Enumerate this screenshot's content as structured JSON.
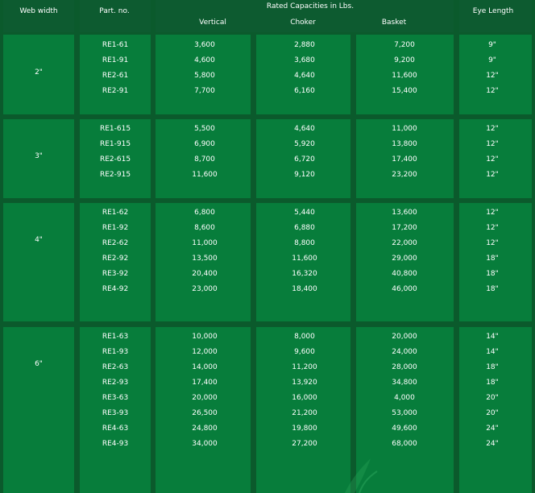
{
  "header": {
    "web_width": "Web width",
    "part_no": "Part. no.",
    "rated": "Rated Capacities in Lbs.",
    "vertical": "Vertical",
    "choker": "Choker",
    "basket": "Basket",
    "eye_length": "Eye Length"
  },
  "groups": [
    {
      "width": "2\"",
      "rows": [
        {
          "part": "RE1-61",
          "vertical": "3,600",
          "choker": "2,880",
          "basket": "7,200",
          "eye": "9\""
        },
        {
          "part": "RE1-91",
          "vertical": "4,600",
          "choker": "3,680",
          "basket": "9,200",
          "eye": "9\""
        },
        {
          "part": "RE2-61",
          "vertical": "5,800",
          "choker": "4,640",
          "basket": "11,600",
          "eye": "12\""
        },
        {
          "part": "RE2-91",
          "vertical": "7,700",
          "choker": "6,160",
          "basket": "15,400",
          "eye": "12\""
        }
      ]
    },
    {
      "width": "3\"",
      "rows": [
        {
          "part": "RE1-615",
          "vertical": "5,500",
          "choker": "4,640",
          "basket": "11,000",
          "eye": "12\""
        },
        {
          "part": "RE1-915",
          "vertical": "6,900",
          "choker": "5,920",
          "basket": "13,800",
          "eye": "12\""
        },
        {
          "part": "RE2-615",
          "vertical": "8,700",
          "choker": "6,720",
          "basket": "17,400",
          "eye": "12\""
        },
        {
          "part": "RE2-915",
          "vertical": "11,600",
          "choker": "9,120",
          "basket": "23,200",
          "eye": "12\""
        }
      ]
    },
    {
      "width": "4\"",
      "rows": [
        {
          "part": "RE1-62",
          "vertical": "6,800",
          "choker": "5,440",
          "basket": "13,600",
          "eye": "12\""
        },
        {
          "part": "RE1-92",
          "vertical": "8,600",
          "choker": "6,880",
          "basket": "17,200",
          "eye": "12\""
        },
        {
          "part": "RE2-62",
          "vertical": "11,000",
          "choker": "8,800",
          "basket": "22,000",
          "eye": "12\""
        },
        {
          "part": "RE2-92",
          "vertical": "13,500",
          "choker": "11,600",
          "basket": "29,000",
          "eye": "18\""
        },
        {
          "part": "RE3-92",
          "vertical": "20,400",
          "choker": "16,320",
          "basket": "40,800",
          "eye": "18\""
        },
        {
          "part": "RE4-92",
          "vertical": "23,000",
          "choker": "18,400",
          "basket": "46,000",
          "eye": "18\""
        }
      ]
    },
    {
      "width": "6\"",
      "rows": [
        {
          "part": "RE1-63",
          "vertical": "10,000",
          "choker": "8,000",
          "basket": "20,000",
          "eye": "14\""
        },
        {
          "part": "RE1-93",
          "vertical": "12,000",
          "choker": "9,600",
          "basket": "24,000",
          "eye": "14\""
        },
        {
          "part": "RE2-63",
          "vertical": "14,000",
          "choker": "11,200",
          "basket": "28,000",
          "eye": "18\""
        },
        {
          "part": "RE2-93",
          "vertical": "17,400",
          "choker": "13,920",
          "basket": "34,800",
          "eye": "18\""
        },
        {
          "part": "RE3-63",
          "vertical": "20,000",
          "choker": "16,000",
          "basket": "4,000",
          "eye": "20\""
        },
        {
          "part": "RE3-93",
          "vertical": "26,500",
          "choker": "21,200",
          "basket": "53,000",
          "eye": "20\""
        },
        {
          "part": "RE4-63",
          "vertical": "24,800",
          "choker": "19,800",
          "basket": "49,600",
          "eye": "24\""
        },
        {
          "part": "RE4-93",
          "vertical": "34,000",
          "choker": "27,200",
          "basket": "68,000",
          "eye": "24\""
        }
      ]
    }
  ]
}
